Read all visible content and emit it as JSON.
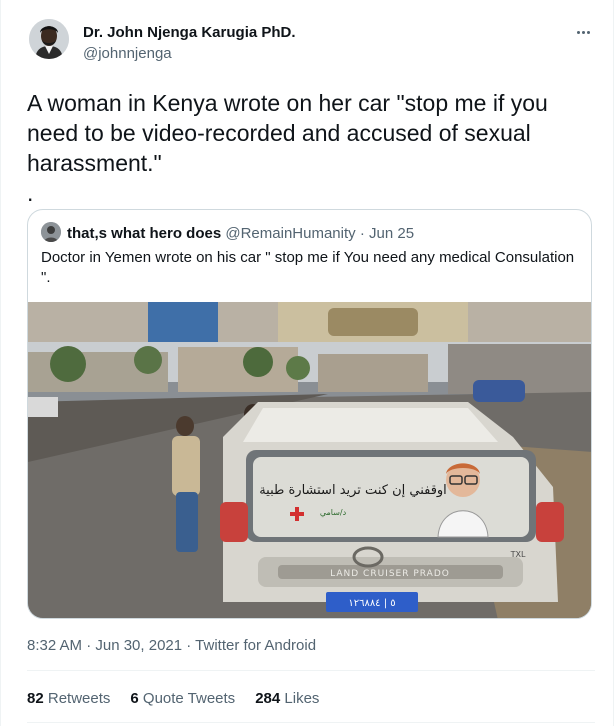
{
  "author": {
    "name": "Dr. John Njenga Karugia PhD.",
    "handle": "@johnnjenga"
  },
  "tweet": {
    "text": "A woman in Kenya wrote on her car \"stop me if you need to be video-recorded and accused of sexual harassment.\"\n."
  },
  "quoted": {
    "name": "that,s what hero does",
    "handle": "@RemainHumanity",
    "separator": "·",
    "date": "Jun 25",
    "text": "Doctor in Yemen wrote on his car \" stop me if You need any medical Consulation \".",
    "image_car_text": "اوقفني إن كنت تريد استشارة طبية",
    "image_car_subtext": "د/سامي",
    "image_badge": "LAND CRUISER PRADO",
    "image_trim": "TXL",
    "image_plate": "٥ | ١٢٦٨٨٤"
  },
  "meta": {
    "timestamp": "8:32 AM · Jun 30, 2021 · Twitter for Android"
  },
  "stats": [
    {
      "count": "82",
      "label": "Retweets"
    },
    {
      "count": "6",
      "label": "Quote Tweets"
    },
    {
      "count": "284",
      "label": "Likes"
    }
  ]
}
